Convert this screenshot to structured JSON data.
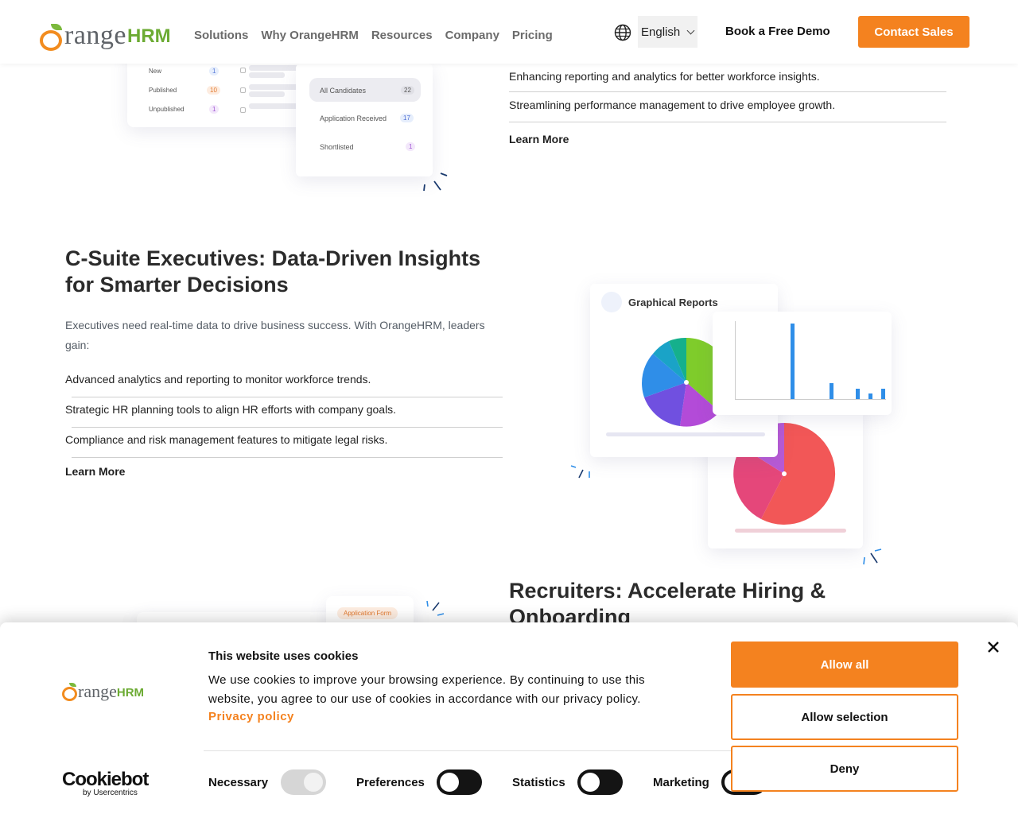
{
  "nav": {
    "logo": {
      "range": "range",
      "hrm": "HRM"
    },
    "menu": [
      "Solutions",
      "Why OrangeHRM",
      "Resources",
      "Company",
      "Pricing"
    ],
    "language": "English",
    "demo_label": "Book a Free Demo",
    "contact_label": "Contact Sales"
  },
  "recruitment_mock": {
    "rows": [
      {
        "label": "New",
        "count": "1"
      },
      {
        "label": "Published",
        "count": "10"
      },
      {
        "label": "Unpublished",
        "count": "1"
      }
    ],
    "side": [
      {
        "label": "All Candidates",
        "count": "22"
      },
      {
        "label": "Application Received",
        "count": "17"
      },
      {
        "label": "Shortlisted",
        "count": "1"
      }
    ]
  },
  "top_section": {
    "items": [
      "Enhancing reporting and analytics for better workforce insights.",
      "Streamlining performance management to drive employee growth."
    ],
    "learn_more": "Learn More"
  },
  "csuite": {
    "title_line1": "C-Suite Executives: Data-Driven Insights",
    "title_line2": "for Smarter Decisions",
    "lead": "Executives need real-time data to drive business success. With OrangeHRM, leaders gain:",
    "items": [
      "Advanced analytics and reporting to monitor workforce trends.",
      "Strategic HR planning tools to align HR efforts with company goals.",
      "Compliance and risk management features to mitigate legal risks."
    ],
    "learn_more": "Learn More"
  },
  "reports_mock": {
    "title": "Graphical Reports"
  },
  "recruiters": {
    "title_line1": "Recruiters: Accelerate Hiring &",
    "title_line2": "Onboarding",
    "form_tag": "Application Form"
  },
  "cookie": {
    "title": "This website uses cookies",
    "text": "We use cookies to improve your browsing experience. By continuing to use this website, you agree to our use of cookies in accordance with our privacy policy.",
    "privacy_link": "Privacy policy",
    "toggles": [
      {
        "label": "Necessary",
        "state": "disabled-on"
      },
      {
        "label": "Preferences",
        "state": "off"
      },
      {
        "label": "Statistics",
        "state": "off"
      },
      {
        "label": "Marketing",
        "state": "off"
      }
    ],
    "allow_all": "Allow all",
    "allow_selection": "Allow selection",
    "deny": "Deny",
    "cookiebot_brand": "Cookiebot",
    "cookiebot_sub": "by Usercentrics"
  },
  "colors": {
    "brand_orange": "#f4821f",
    "brand_green": "#6cab33"
  }
}
